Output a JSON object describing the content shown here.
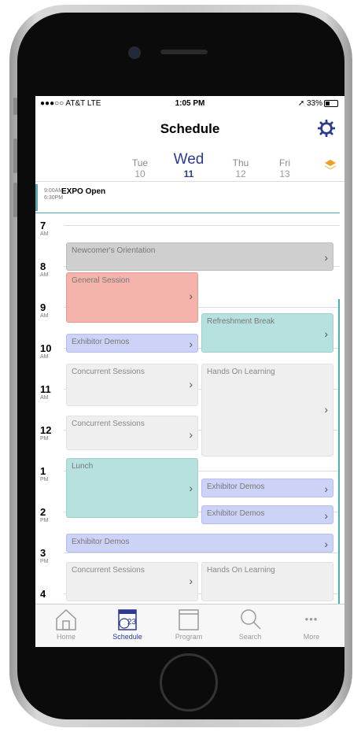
{
  "status": {
    "carrier": "●●●○○ AT&T  LTE",
    "time": "1:05 PM",
    "battery": "➚ 33%"
  },
  "nav": {
    "title": "Schedule"
  },
  "days": [
    {
      "name": "Tue",
      "date": "10"
    },
    {
      "name": "Wed",
      "date": "11"
    },
    {
      "name": "Thu",
      "date": "12"
    },
    {
      "name": "Fri",
      "date": "13"
    }
  ],
  "allday": {
    "start": "9:00AM",
    "end": "6:30PM",
    "title": "EXPO Open"
  },
  "hours": [
    {
      "h": "7",
      "ap": "AM"
    },
    {
      "h": "8",
      "ap": "AM"
    },
    {
      "h": "9",
      "ap": "AM"
    },
    {
      "h": "10",
      "ap": "AM"
    },
    {
      "h": "11",
      "ap": "AM"
    },
    {
      "h": "12",
      "ap": "PM"
    },
    {
      "h": "1",
      "ap": "PM"
    },
    {
      "h": "2",
      "ap": "PM"
    },
    {
      "h": "3",
      "ap": "PM"
    },
    {
      "h": "4",
      "ap": ""
    }
  ],
  "events": {
    "newcomers": "Newcomer's Orientation",
    "general": "General Session",
    "refreshment": "Refreshment Break",
    "exhibitor1": "Exhibitor Demos",
    "concurrent1": "Concurrent Sessions",
    "handson1": "Hands On Learning",
    "concurrent2": "Concurrent Sessions",
    "lunch": "Lunch",
    "exhibitor2": "Exhibitor Demos",
    "exhibitor3": "Exhibitor Demos",
    "exhibitor4": "Exhibitor Demos",
    "concurrent3": "Concurrent Sessions",
    "handson2": "Hands On Learning",
    "chevron": "›"
  },
  "tabs": [
    {
      "label": "Home",
      "icon": "home-icon"
    },
    {
      "label": "Schedule",
      "icon": "calendar-icon"
    },
    {
      "label": "Program",
      "icon": "program-icon"
    },
    {
      "label": "Search",
      "icon": "search-icon"
    },
    {
      "label": "More",
      "icon": "more-icon",
      "glyph": "•••"
    }
  ],
  "calendar_badge": "23",
  "colors": {
    "accent": "#2c3a8f",
    "teal": "#48b0b0",
    "red": "#f4b3ab",
    "blue": "#cdd3f6",
    "gear": "#2c3a8f",
    "layers": "#f0a020"
  }
}
